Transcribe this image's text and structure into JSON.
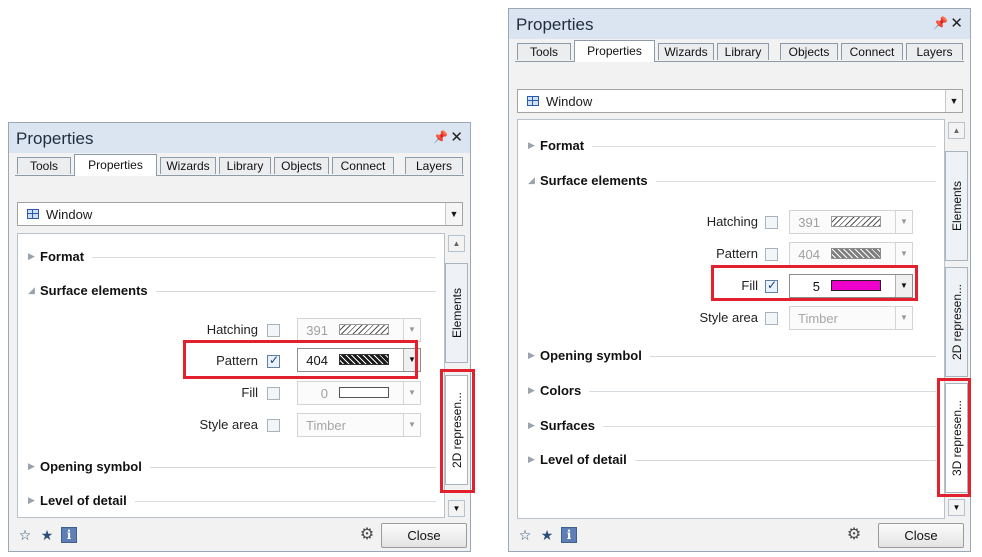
{
  "panel_left": {
    "title": "Properties",
    "pin": "ȧ",
    "close_glyph": "✕",
    "tabs": [
      "Tools",
      "Properties",
      "Wizards",
      "Library",
      "Objects",
      "Connect",
      "Layers"
    ],
    "active_tab": "Properties",
    "object_select": "Window",
    "sections": [
      "Format",
      "Surface elements",
      "Opening symbol",
      "Level of detail"
    ],
    "rows": {
      "hatching": {
        "label": "Hatching",
        "value": "391"
      },
      "pattern": {
        "label": "Pattern",
        "value": "404"
      },
      "fill": {
        "label": "Fill",
        "value": "0"
      },
      "style_area": {
        "label": "Style area",
        "value": "Timber"
      }
    },
    "side_tabs": [
      "Elements",
      "2D represen..."
    ],
    "close_button": "Close"
  },
  "panel_right": {
    "title": "Properties",
    "pin": "ȧ",
    "close_glyph": "✕",
    "tabs": [
      "Tools",
      "Properties",
      "Wizards",
      "Library",
      "Objects",
      "Connect",
      "Layers"
    ],
    "active_tab": "Properties",
    "object_select": "Window",
    "sections": [
      "Format",
      "Surface elements",
      "Opening symbol",
      "Colors",
      "Surfaces",
      "Level of detail"
    ],
    "rows": {
      "hatching": {
        "label": "Hatching",
        "value": "391"
      },
      "pattern": {
        "label": "Pattern",
        "value": "404"
      },
      "fill": {
        "label": "Fill",
        "value": "5"
      },
      "style_area": {
        "label": "Style area",
        "value": "Timber"
      }
    },
    "side_tabs": [
      "Elements",
      "2D represen...",
      "3D represen..."
    ],
    "close_button": "Close"
  },
  "colors": {
    "highlight": "#e2202e",
    "fill_magenta": "#ee00cc",
    "title_bar": "#dbe5f1"
  }
}
